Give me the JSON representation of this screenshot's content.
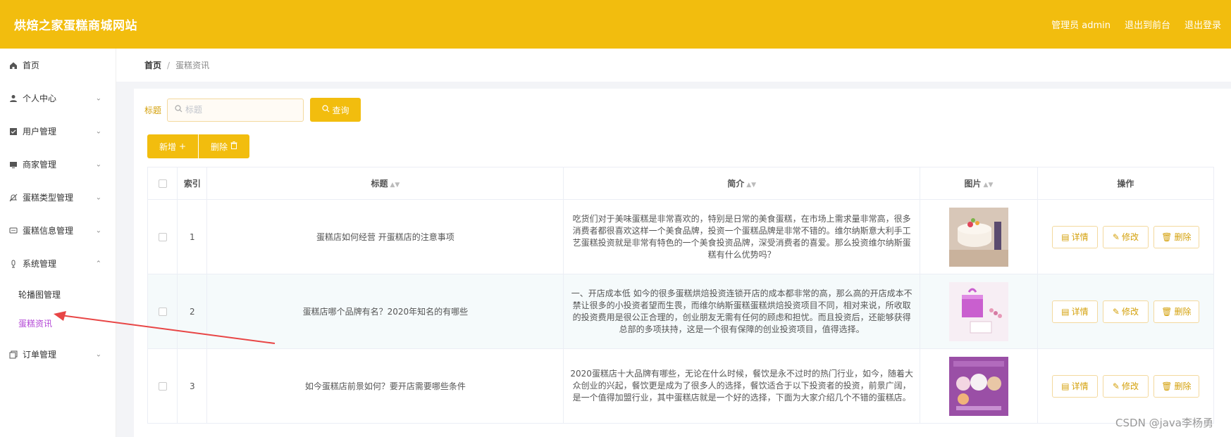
{
  "header": {
    "title": "烘焙之家蛋糕商城网站",
    "user": "管理员 admin",
    "front": "退出到前台",
    "logout": "退出登录"
  },
  "sidebar": {
    "items": [
      {
        "label": "首页",
        "icon": "home-icon"
      },
      {
        "label": "个人中心",
        "icon": "user-icon"
      },
      {
        "label": "用户管理",
        "icon": "checkbox-icon"
      },
      {
        "label": "商家管理",
        "icon": "monitor-icon"
      },
      {
        "label": "蛋糕类型管理",
        "icon": "bell-off-icon"
      },
      {
        "label": "蛋糕信息管理",
        "icon": "chat-icon"
      },
      {
        "label": "系统管理",
        "icon": "mic-icon"
      }
    ],
    "sub": [
      {
        "label": "轮播图管理"
      },
      {
        "label": "蛋糕资讯"
      }
    ],
    "order": {
      "label": "订单管理",
      "icon": "copy-icon"
    }
  },
  "breadcrumb": {
    "home": "首页",
    "sep": "/",
    "current": "蛋糕资讯"
  },
  "search": {
    "label": "标题",
    "placeholder": "标题",
    "button": "查询"
  },
  "actions": {
    "add": "新增",
    "delete": "删除"
  },
  "table": {
    "headers": {
      "index": "索引",
      "title": "标题",
      "intro": "简介",
      "image": "图片",
      "ops": "操作"
    },
    "rows": [
      {
        "index": "1",
        "title": "蛋糕店如何经营 开蛋糕店的注意事项",
        "intro": "吃货们对于美味蛋糕是非常喜欢的，特别是日常的美食蛋糕，在市场上需求量非常高，很多消费者都很喜欢这样一个美食品牌，投资一个蛋糕品牌是非常不错的。维尔纳斯意大利手工艺蛋糕投资就是非常有特色的一个美食投资品牌，深受消费者的喜爱。那么投资维尔纳斯蛋糕有什么优势吗？"
      },
      {
        "index": "2",
        "title": "蛋糕店哪个品牌有名？2020年知名的有哪些",
        "intro": "一、开店成本低 如今的很多蛋糕烘焙投资连锁开店的成本都非常的高，那么高的开店成本不禁让很多的小投资者望而生畏，而维尔纳斯蛋糕蛋糕烘焙投资项目不同，相对来说，所收取的投资费用是很公正合理的，创业朋友无需有任何的顾虑和担忧。而且投资后，还能够获得总部的多项扶持，这是一个很有保障的创业投资项目，值得选择。"
      },
      {
        "index": "3",
        "title": "如今蛋糕店前景如何？要开店需要哪些条件",
        "intro": "2020蛋糕店十大品牌有哪些，无论在什么时候，餐饮是永不过时的热门行业，如今，随着大众创业的兴起，餐饮更是成为了很多人的选择，餐饮适合于以下投资者的投资，前景广阔，是一个值得加盟行业，其中蛋糕店就是一个好的选择，下面为大家介绍几个不错的蛋糕店。"
      }
    ],
    "op_labels": {
      "detail": "详情",
      "edit": "修改",
      "delete": "删除"
    }
  },
  "watermark": "CSDN @java李杨勇",
  "colors": {
    "accent": "#f2bd0e",
    "active_menu": "#b347d6",
    "annotation_arrow": "#e84545"
  }
}
